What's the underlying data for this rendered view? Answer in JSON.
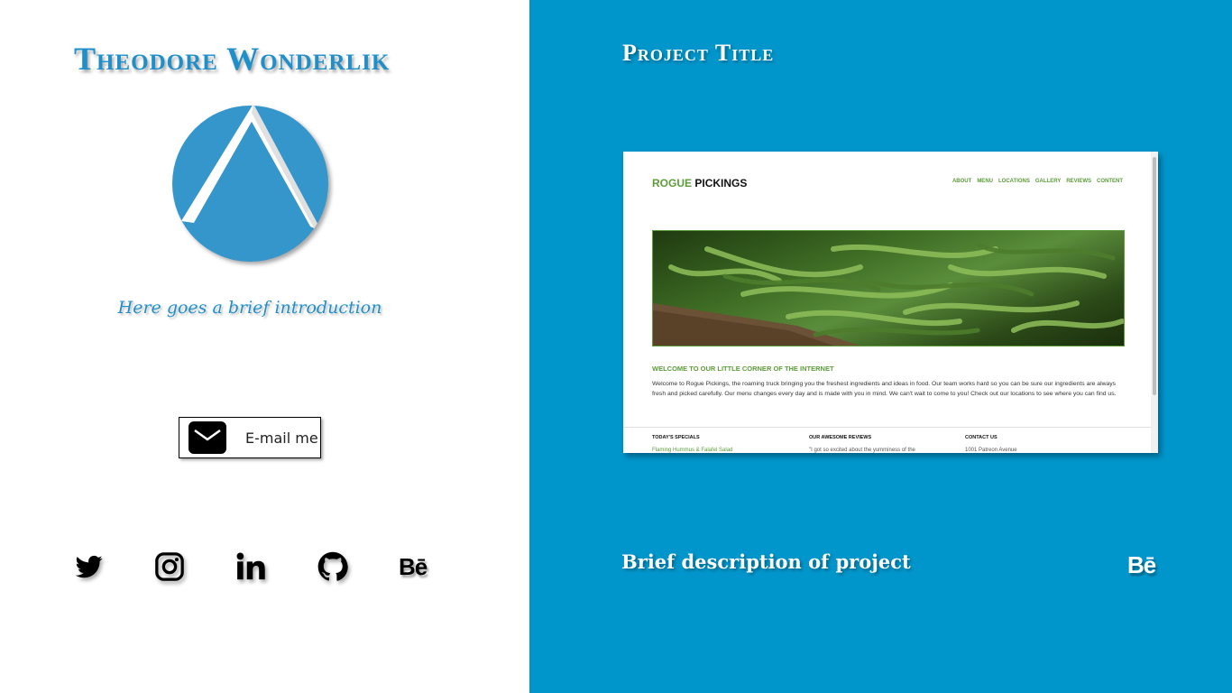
{
  "profile": {
    "name": "Theodore Wonderlik",
    "logo_icon": "triangle-a-logo-icon",
    "intro": "Here goes a brief introduction"
  },
  "contact": {
    "email_label": "E-mail me",
    "email_icon": "mail-icon"
  },
  "social_links": [
    {
      "name": "twitter",
      "icon": "twitter-icon"
    },
    {
      "name": "instagram",
      "icon": "instagram-icon"
    },
    {
      "name": "linkedin",
      "icon": "linkedin-icon",
      "text": "in"
    },
    {
      "name": "github",
      "icon": "github-icon"
    },
    {
      "name": "behance",
      "icon": "behance-icon",
      "text": "Bē"
    }
  ],
  "project": {
    "title": "Project Title",
    "description": "Brief description of project",
    "behance_text": "Bē",
    "preview": {
      "brand_accent": "ROGUE",
      "brand_rest": "PICKINGS",
      "nav": [
        "ABOUT",
        "MENU",
        "LOCATIONS",
        "GALLERY",
        "REVIEWS",
        "CONTENT"
      ],
      "welcome_heading": "WELCOME TO OUR LITTLE CORNER OF THE INTERNET",
      "welcome_text": "Welcome to Rogue Pickings, the roaming truck bringing you the freshest ingredients and ideas in food. Our team works hard so you can be sure our ingredients are always fresh and picked carefully. Our menu changes every day and is made with you in mind. We can't wait to come to you! Check out our locations to see where you can find us.",
      "columns": [
        {
          "heading": "TODAY'S SPECIALS",
          "first_line": "Flaming Hummus & Falafel Salad"
        },
        {
          "heading": "OUR AWESOME REVIEWS",
          "first_line": "\"I got so excited about the yumminess of the"
        },
        {
          "heading": "CONTACT US",
          "first_line": "1001 Patreon Avenue"
        }
      ]
    }
  },
  "colors": {
    "accent_blue": "#1f8fc9",
    "panel_blue": "#0096cb",
    "logo_blue": "#3596cc",
    "preview_green": "#5c9c3a"
  }
}
